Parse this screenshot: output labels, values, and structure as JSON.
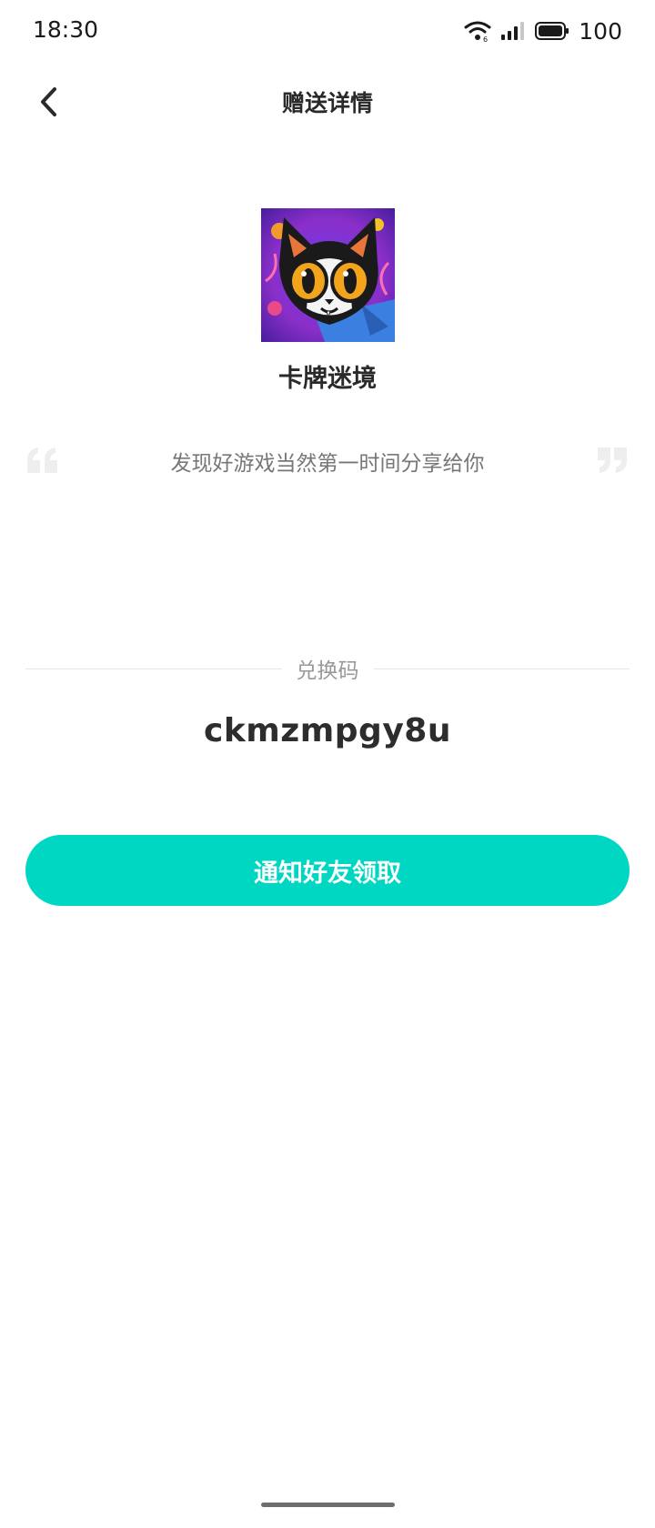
{
  "status_bar": {
    "time": "18:30",
    "battery_level": "100",
    "icons": [
      "wifi-icon",
      "signal-icon",
      "battery-icon"
    ]
  },
  "nav": {
    "title": "赠送详情",
    "back_icon": "chevron-left-icon"
  },
  "game": {
    "name": "卡牌迷境",
    "cover_icon": "cartoon-cat-cover"
  },
  "quote": {
    "text": "发现好游戏当然第一时间分享给你",
    "open_icon": "quote-open-icon",
    "close_icon": "quote-close-icon"
  },
  "redeem": {
    "label": "兑换码",
    "code": "ckmzmpgy8u"
  },
  "actions": {
    "notify_label": "通知好友领取"
  },
  "colors": {
    "accent": "#00d7c3",
    "title_text": "#2a2a2a",
    "muted_text": "#777777",
    "divider": "#e6e6e6"
  }
}
